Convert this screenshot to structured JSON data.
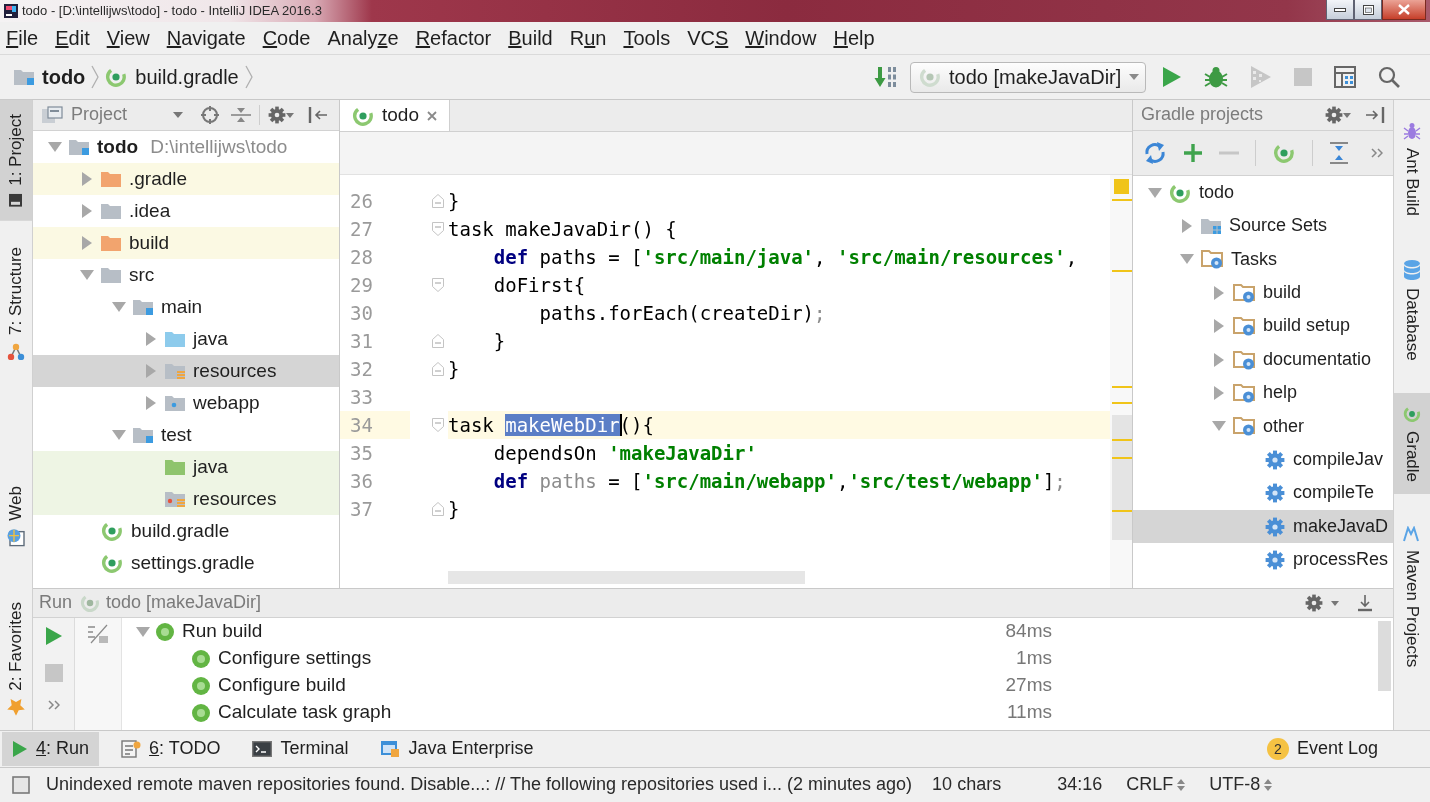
{
  "window": {
    "title": "todo - [D:\\intellijws\\todo] - todo - IntelliJ IDEA 2016.3"
  },
  "menu": [
    {
      "mnemonic": "F",
      "after": "ile"
    },
    {
      "mnemonic": "E",
      "after": "dit"
    },
    {
      "mnemonic": "V",
      "after": "iew"
    },
    {
      "mnemonic": "N",
      "after": "avigate"
    },
    {
      "mnemonic": "C",
      "after": "ode"
    },
    {
      "before": "Analy",
      "mnemonic": "z",
      "after": "e"
    },
    {
      "mnemonic": "R",
      "after": "efactor"
    },
    {
      "mnemonic": "B",
      "after": "uild"
    },
    {
      "before": "R",
      "mnemonic": "u",
      "after": "n"
    },
    {
      "mnemonic": "T",
      "after": "ools"
    },
    {
      "before": "VC",
      "mnemonic": "S"
    },
    {
      "mnemonic": "W",
      "after": "indow"
    },
    {
      "mnemonic": "H",
      "after": "elp"
    }
  ],
  "breadcrumbs": [
    {
      "label": "todo",
      "kind": "module"
    },
    {
      "label": "build.gradle",
      "kind": "gradle-file"
    }
  ],
  "main_toolbar": {
    "before_config": [
      {
        "kind": "make",
        "disabled": false
      }
    ],
    "run_configuration": "todo [makeJavaDir]",
    "after_config": [
      {
        "kind": "run",
        "disabled": false
      },
      {
        "kind": "debug",
        "disabled": false
      },
      {
        "kind": "coverage",
        "disabled": true
      },
      {
        "kind": "stop",
        "disabled": true
      },
      {
        "kind": "project-structure",
        "disabled": false
      },
      {
        "kind": "search",
        "disabled": false
      }
    ]
  },
  "left_stripe": {
    "top": [
      {
        "label": "1: Project",
        "kind": "project",
        "selected": true
      },
      {
        "label": "7: Structure",
        "kind": "structure",
        "selected": false
      }
    ],
    "top_split": [
      {
        "label": "Web",
        "kind": "web",
        "selected": false
      }
    ],
    "bottom": [
      {
        "label": "2: Favorites",
        "kind": "favorites",
        "selected": false
      }
    ]
  },
  "project_panel": {
    "title": "Project",
    "tree": [
      {
        "label": "todo",
        "path": "D:\\intellijws\\todo",
        "kind": "module",
        "expanded": true,
        "selected": false,
        "children": [
          {
            "label": ".gradle",
            "kind": "excluded",
            "expanded": false,
            "selected": false
          },
          {
            "label": ".idea",
            "kind": "folder",
            "expanded": false,
            "selected": false
          },
          {
            "label": "build",
            "kind": "excluded",
            "expanded": false,
            "selected": false
          },
          {
            "label": "src",
            "kind": "folder",
            "expanded": true,
            "selected": false,
            "children": [
              {
                "label": "main",
                "kind": "module",
                "expanded": true,
                "selected": false,
                "children": [
                  {
                    "label": "java",
                    "kind": "source",
                    "expanded": false,
                    "selected": false
                  },
                  {
                    "label": "resources",
                    "kind": "resources",
                    "expanded": false,
                    "selected": true
                  },
                  {
                    "label": "webapp",
                    "kind": "webapp",
                    "expanded": false,
                    "selected": false
                  }
                ]
              },
              {
                "label": "test",
                "kind": "module",
                "expanded": true,
                "selected": false,
                "children": [
                  {
                    "label": "java",
                    "kind": "test-source",
                    "selected": false
                  },
                  {
                    "label": "resources",
                    "kind": "test-resources",
                    "selected": false
                  }
                ]
              }
            ]
          },
          {
            "label": "build.gradle",
            "kind": "gradle-file",
            "selected": false
          },
          {
            "label": "settings.gradle",
            "kind": "gradle-file",
            "selected": false
          }
        ]
      }
    ]
  },
  "editor": {
    "tabs": [
      {
        "label": "todo",
        "selected": true
      }
    ],
    "lines": [
      {
        "number": "26",
        "fold_start": false,
        "fold_end": true,
        "current": false,
        "tokens": [
          {
            "text": "}",
            "kind": "plain"
          }
        ]
      },
      {
        "number": "27",
        "fold_start": true,
        "fold_end": false,
        "current": false,
        "tokens": [
          {
            "text": "task makeJavaDir() {",
            "kind": "plain"
          }
        ]
      },
      {
        "number": "28",
        "fold_start": false,
        "fold_end": false,
        "current": false,
        "tokens": [
          {
            "text": "    def",
            "kind": "keyword"
          },
          {
            "text": " paths = [",
            "kind": "plain"
          },
          {
            "text": "'src/main/java'",
            "kind": "string"
          },
          {
            "text": ", ",
            "kind": "plain"
          },
          {
            "text": "'src/main/resources'",
            "kind": "string"
          },
          {
            "text": ",",
            "kind": "plain"
          }
        ]
      },
      {
        "number": "29",
        "fold_start": true,
        "fold_end": false,
        "current": false,
        "tokens": [
          {
            "text": "    doFirst{",
            "kind": "plain"
          }
        ]
      },
      {
        "number": "30",
        "fold_start": false,
        "fold_end": false,
        "current": false,
        "tokens": [
          {
            "text": "        paths.forEach(createDir)",
            "kind": "plain"
          },
          {
            "text": ";",
            "kind": "dim"
          }
        ]
      },
      {
        "number": "31",
        "fold_start": false,
        "fold_end": true,
        "current": false,
        "tokens": [
          {
            "text": "    }",
            "kind": "plain"
          }
        ]
      },
      {
        "number": "32",
        "fold_start": false,
        "fold_end": true,
        "current": false,
        "tokens": [
          {
            "text": "}",
            "kind": "plain"
          }
        ]
      },
      {
        "number": "33",
        "fold_start": false,
        "fold_end": false,
        "current": false
      },
      {
        "number": "34",
        "fold_start": true,
        "fold_end": false,
        "current": true,
        "tokens": [
          {
            "text": "task ",
            "kind": "plain"
          },
          {
            "text": "makeWebDir",
            "kind": "selected"
          },
          {
            "text": "(){",
            "kind": "plain"
          }
        ]
      },
      {
        "number": "35",
        "fold_start": false,
        "fold_end": false,
        "current": false,
        "tokens": [
          {
            "text": "    dependsOn ",
            "kind": "plain"
          },
          {
            "text": "'makeJavaDir'",
            "kind": "string"
          }
        ]
      },
      {
        "number": "36",
        "fold_start": false,
        "fold_end": false,
        "current": false,
        "tokens": [
          {
            "text": "    def ",
            "kind": "keyword"
          },
          {
            "text": "paths",
            "kind": "dim"
          },
          {
            "text": " = [",
            "kind": "plain"
          },
          {
            "text": "'src/main/webapp'",
            "kind": "string"
          },
          {
            "text": ",",
            "kind": "plain"
          },
          {
            "text": "'src/test/webapp'",
            "kind": "string"
          },
          {
            "text": "]",
            "kind": "plain"
          },
          {
            "text": ";",
            "kind": "dim"
          }
        ]
      },
      {
        "number": "37",
        "fold_start": false,
        "fold_end": true,
        "current": false,
        "tokens": [
          {
            "text": "}",
            "kind": "plain"
          }
        ]
      }
    ]
  },
  "gradle_panel": {
    "title": "Gradle projects",
    "toolbar": [
      {
        "kind": "refresh",
        "disabled": false
      },
      {
        "kind": "add",
        "disabled": false
      },
      {
        "kind": "remove",
        "disabled": true
      },
      {
        "kind": "execute",
        "disabled": false
      },
      {
        "kind": "collapse",
        "disabled": false
      }
    ],
    "tree": [
      {
        "label": "todo",
        "kind": "project",
        "expanded": true,
        "selected": false,
        "children": [
          {
            "label": "Source Sets",
            "kind": "source-sets",
            "expanded": false,
            "selected": false
          },
          {
            "label": "Tasks",
            "kind": "task-folder",
            "expanded": true,
            "selected": false,
            "children": [
              {
                "label": "build",
                "kind": "task-folder",
                "expanded": false,
                "selected": false
              },
              {
                "label": "build setup",
                "kind": "task-folder",
                "expanded": false,
                "selected": false
              },
              {
                "label": "documentatio",
                "kind": "task-folder",
                "expanded": false,
                "selected": false
              },
              {
                "label": "help",
                "kind": "task-folder",
                "expanded": false,
                "selected": false
              },
              {
                "label": "other",
                "kind": "task-folder",
                "expanded": true,
                "selected": false,
                "children": [
                  {
                    "label": "compileJav",
                    "kind": "task",
                    "selected": false
                  },
                  {
                    "label": "compileTe",
                    "kind": "task",
                    "selected": false
                  },
                  {
                    "label": "makeJavaD",
                    "kind": "task",
                    "selected": true
                  },
                  {
                    "label": "processRes",
                    "kind": "task",
                    "selected": false
                  }
                ]
              }
            ]
          }
        ]
      }
    ]
  },
  "right_stripe": [
    {
      "label": "Ant Build",
      "kind": "ant",
      "selected": false
    },
    {
      "label": "Database",
      "kind": "database",
      "selected": false
    },
    {
      "label": "Gradle",
      "kind": "gradle",
      "selected": true
    },
    {
      "label": "Maven Projects",
      "kind": "maven",
      "selected": false
    }
  ],
  "run_panel": {
    "title": "Run",
    "tab": "todo [makeJavaDir]",
    "toolbar": [
      {
        "kind": "rerun",
        "disabled": false
      },
      {
        "kind": "stop",
        "disabled": true
      },
      {
        "kind": "more",
        "disabled": false
      }
    ],
    "tree": [
      {
        "label": "Run build",
        "time": "84ms",
        "passed": true,
        "expanded": true,
        "children": [
          {
            "label": "Configure settings",
            "time": "1ms",
            "passed": true
          },
          {
            "label": "Configure build",
            "time": "27ms",
            "passed": true
          },
          {
            "label": "Calculate task graph",
            "time": "11ms",
            "passed": true
          }
        ]
      }
    ]
  },
  "tool_tabs": [
    {
      "mnemonic": "4",
      "after": ": Run",
      "kind": "run",
      "selected": true
    },
    {
      "mnemonic": "6",
      "after": ": TODO",
      "kind": "todo",
      "selected": false
    },
    {
      "label": "Terminal",
      "kind": "terminal",
      "selected": false
    },
    {
      "label": "Java Enterprise",
      "kind": "javaee",
      "selected": false
    }
  ],
  "event_log": {
    "badge": "2",
    "label": "Event Log"
  },
  "status_bar": {
    "message": "Unindexed remote maven repositories found. Disable...: // The following repositories used i... (2 minutes ago)",
    "fields": [
      "10 chars",
      "34:16"
    ],
    "line_separator": "CRLF",
    "encoding": "UTF-8"
  }
}
